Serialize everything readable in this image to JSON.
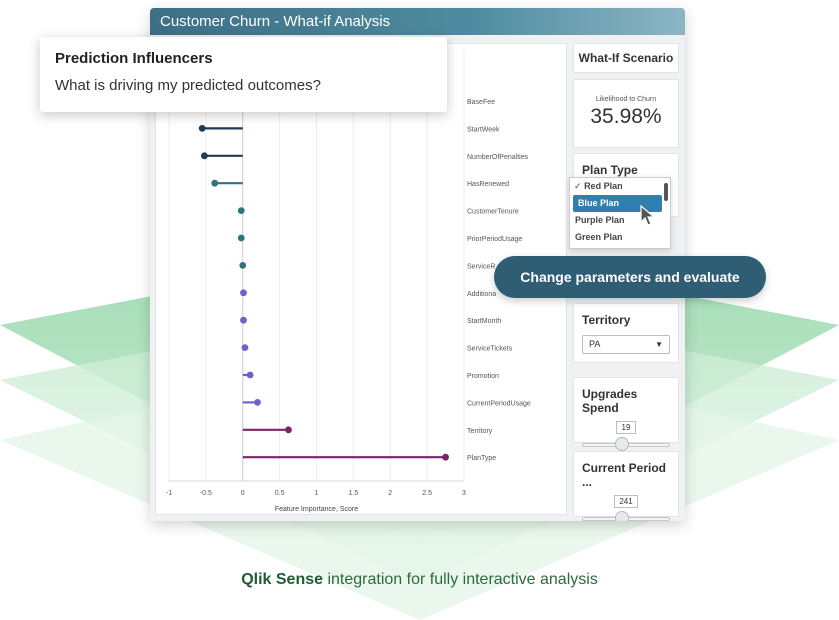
{
  "window": {
    "title": "Customer Churn - What-if Analysis"
  },
  "influencers": {
    "title": "Prediction Influencers",
    "subtitle": "What is driving my predicted outcomes?"
  },
  "chart_data": {
    "type": "lollipop",
    "orientation": "horizontal",
    "xlabel": "Feature Importance, Score",
    "xlim": [
      -1,
      3
    ],
    "xticks": [
      "-1",
      "-0.5",
      "0",
      "0.5",
      "1",
      "1.5",
      "2",
      "2.5",
      "3"
    ],
    "tick_values": [
      -1,
      -0.5,
      0,
      0.5,
      1,
      1.5,
      2,
      2.5,
      3
    ],
    "grid": true,
    "categories": [
      "BaseFee",
      "StartWeek",
      "NumberOfPenalties",
      "HasRenewed",
      "CustomerTenure",
      "PriorPeriodUsage",
      "ServiceR",
      "Additiona",
      "StartMonth",
      "ServiceTickets",
      "Promotion",
      "CurrentPeriodUsage",
      "Territory",
      "PlanType"
    ],
    "values": [
      null,
      -0.55,
      -0.52,
      -0.38,
      -0.02,
      -0.02,
      0.0,
      0.01,
      0.01,
      0.03,
      0.1,
      0.2,
      0.62,
      2.75
    ],
    "colors": [
      "#1f3b57",
      "#1f3b57",
      "#1f3b57",
      "#2f7380",
      "#2f7380",
      "#2f7380",
      "#2f7380",
      "#6b63c9",
      "#6b63c9",
      "#6b63c9",
      "#6b63c9",
      "#6b63c9",
      "#7d2366",
      "#7d2366"
    ]
  },
  "scenario": {
    "header": "What-If Scenario",
    "likelihood_label": "Likelihood to Churn",
    "likelihood_value": "35.98%",
    "plan_type_label": "Plan Type",
    "plan_options": [
      "Red Plan",
      "Blue Plan",
      "Purple Plan",
      "Green Plan"
    ],
    "checked_mark": "✓",
    "territory_label": "Territory",
    "territory_value": "PA",
    "upgrades_label": "Upgrades Spend",
    "upgrades_value": "19",
    "upgrades_level": 0.45,
    "current_period_label": "Current Period ...",
    "current_period_value": "241",
    "current_period_level": 0.45
  },
  "callout": {
    "label": "Change parameters and evaluate"
  },
  "caption": {
    "brand": "Qlik Sense",
    "text": " integration for fully interactive analysis"
  },
  "colors": {
    "accent": "#2e5d74",
    "brand_green": "#2b6b3b",
    "selected": "#2f7fb0"
  }
}
